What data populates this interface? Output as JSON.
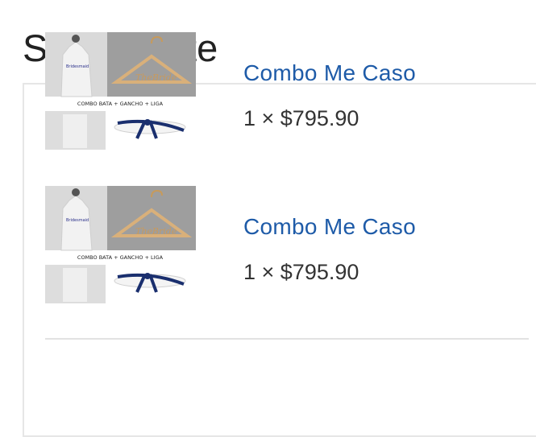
{
  "page": {
    "title": "Su paquete"
  },
  "package": {
    "items": [
      {
        "name": "Combo Me Caso",
        "price_text": "1 × $795.90",
        "image": {
          "caption": "COMBO BATA + GANCHO + LIGA",
          "robe_text": "Bridesmaid",
          "hanger_text": "TheBride"
        }
      },
      {
        "name": "Combo Me Caso",
        "price_text": "1 × $795.90",
        "image": {
          "caption": "COMBO BATA + GANCHO + LIGA",
          "robe_text": "Bridesmaid",
          "hanger_text": "TheBride"
        }
      }
    ]
  },
  "colors": {
    "link": "#1e5ba8",
    "text": "#333333",
    "border": "#e6e6e6",
    "garter": "#1a2f6e"
  }
}
